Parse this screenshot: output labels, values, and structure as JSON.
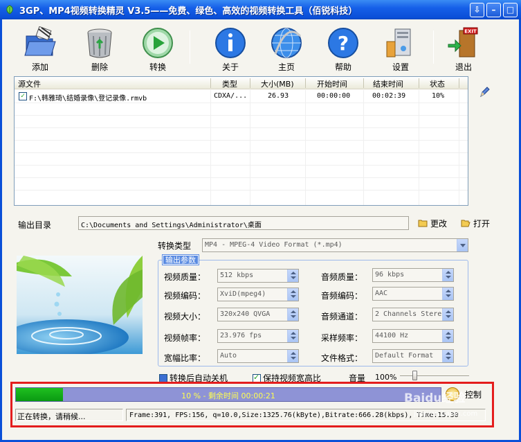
{
  "window": {
    "title": "3GP、MP4视频转换精灵 V3.5——免费、绿色、高效的视频转换工具（佰锐科技）",
    "icon": "app-leaf-icon"
  },
  "toolbar": {
    "add": "添加",
    "delete": "删除",
    "convert": "转换",
    "about": "关于",
    "home": "主页",
    "help": "帮助",
    "settings": "设置",
    "exit": "退出"
  },
  "filelist": {
    "headers": [
      "源文件",
      "类型",
      "大小(MB)",
      "开始时间",
      "结束时间",
      "状态"
    ],
    "rows": [
      {
        "checked": true,
        "source": "F:\\韩雅琦\\结婚录像\\登记录像.rmvb",
        "type": "CDXA/...",
        "size": "26.93",
        "start": "00:00:00",
        "end": "00:02:39",
        "status": "10%"
      }
    ]
  },
  "output": {
    "label": "输出目录",
    "path": "C:\\Documents and Settings\\Administrator\\桌面",
    "change": "更改",
    "open": "打开"
  },
  "convert_type": {
    "label": "转换类型",
    "value": "MP4 - MPEG-4 Video Format (*.mp4)"
  },
  "params": {
    "legend": "输出参数",
    "video_quality": {
      "label": "视频质量：",
      "value": "512 kbps"
    },
    "video_codec": {
      "label": "视频编码：",
      "value": "XviD(mpeg4)"
    },
    "video_size": {
      "label": "视频大小：",
      "value": "320x240 QVGA"
    },
    "video_fps": {
      "label": "视频帧率：",
      "value": "23.976 fps"
    },
    "aspect": {
      "label": "宽幅比率：",
      "value": "Auto"
    },
    "audio_quality": {
      "label": "音频质量：",
      "value": "96  kbps"
    },
    "audio_codec": {
      "label": "音频编码：",
      "value": "AAC"
    },
    "audio_channel": {
      "label": "音频通道：",
      "value": "2 Channels Stereo"
    },
    "sample_rate": {
      "label": "采样频率：",
      "value": "44100 Hz"
    },
    "file_format": {
      "label": "文件格式：",
      "value": "Default Format"
    }
  },
  "options": {
    "auto_shutdown": {
      "label": "转换后自动关机",
      "checked": false
    },
    "keep_aspect": {
      "label": "保持视频宽高比",
      "checked": true
    },
    "volume_label": "音量",
    "volume_value": "100%",
    "volume_fraction": 0.22
  },
  "progress": {
    "fraction": 0.11,
    "text": "10 % - 剩余时间 00:00:21",
    "control": "控制"
  },
  "status": {
    "left": "正在转换，请稍候...",
    "right": "Frame:391, FPS:156, q=10.0,Size:1325.76(kByte),Bitrate:666.28(kbps), Time:15.30"
  },
  "watermark": {
    "text": "Baidu经验",
    "url": "jingyan.baidu.com"
  },
  "colors": {
    "titlebar": "#0A4FD8",
    "progress_fill": "#1FC020",
    "progress_bg": "#8E93D6",
    "highlight_box": "#E41D1D"
  }
}
